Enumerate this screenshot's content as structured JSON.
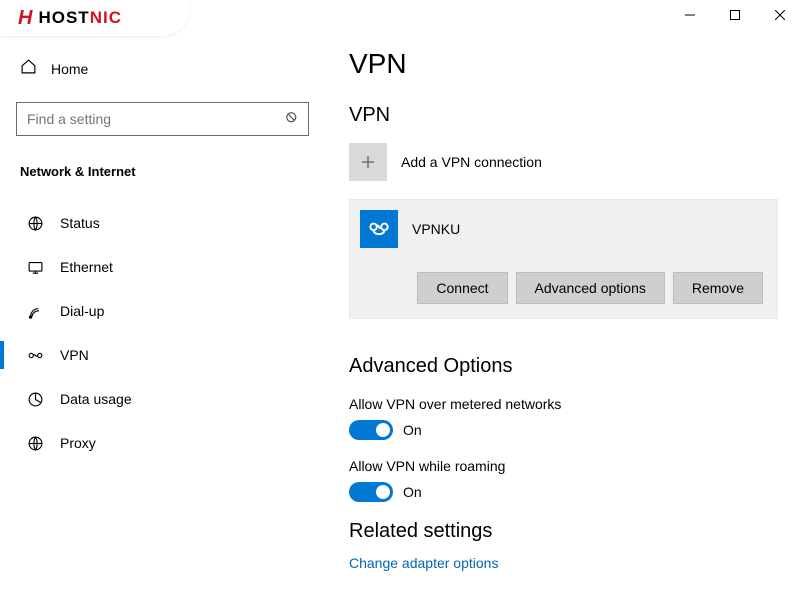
{
  "logo": {
    "brand1": "HOST",
    "brand2": "NIC"
  },
  "sidebar": {
    "home": "Home",
    "searchPlaceholder": "Find a setting",
    "category": "Network & Internet",
    "items": [
      {
        "label": "Status"
      },
      {
        "label": "Ethernet"
      },
      {
        "label": "Dial-up"
      },
      {
        "label": "VPN"
      },
      {
        "label": "Data usage"
      },
      {
        "label": "Proxy"
      }
    ]
  },
  "main": {
    "title": "VPN",
    "vpnSection": "VPN",
    "addLabel": "Add a VPN connection",
    "vpnEntry": {
      "name": "VPNKU",
      "connect": "Connect",
      "advanced": "Advanced options",
      "remove": "Remove"
    },
    "advTitle": "Advanced Options",
    "opt1": {
      "label": "Allow VPN over metered networks",
      "state": "On"
    },
    "opt2": {
      "label": "Allow VPN while roaming",
      "state": "On"
    },
    "relTitle": "Related settings",
    "link1": "Change adapter options"
  }
}
